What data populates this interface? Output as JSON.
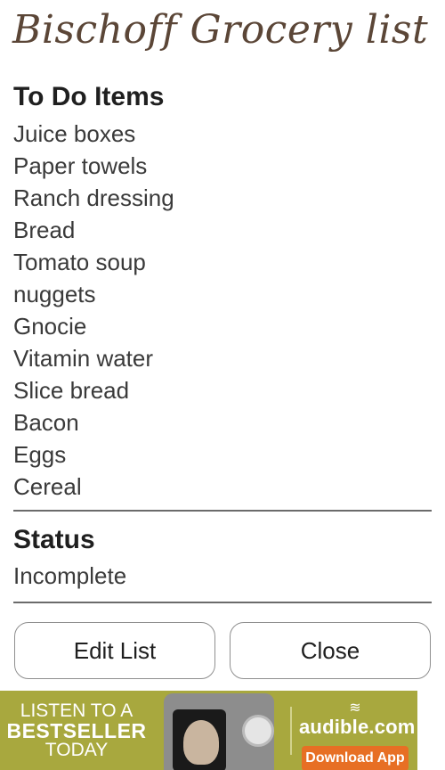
{
  "app": {
    "title": "Bischoff Grocery list"
  },
  "todo": {
    "heading": "To Do Items",
    "items": [
      "Juice boxes",
      "Paper towels",
      "Ranch dressing",
      "Bread",
      "Tomato soup",
      "nuggets",
      "Gnocie",
      "Vitamin water",
      "Slice bread",
      "Bacon",
      "Eggs",
      "Cereal"
    ]
  },
  "status": {
    "heading": "Status",
    "value": "Incomplete"
  },
  "buttons": {
    "edit": "Edit List",
    "close": "Close"
  },
  "ad": {
    "line1": "LISTEN TO A",
    "line2": "BESTSELLER",
    "line3": "TODAY",
    "brand": "audible.com",
    "cta": "Download App",
    "colors": {
      "banner": "#a8a83e",
      "cta": "#e76f24"
    }
  }
}
